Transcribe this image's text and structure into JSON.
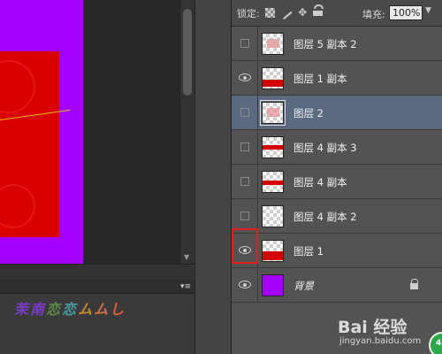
{
  "lock_bar": {
    "lock_label": "锁定:",
    "fill_label": "填充:",
    "fill_value": "100%"
  },
  "layers": [
    {
      "name": "图层 5 副本 2",
      "visible": false,
      "thumb": "pink-swatch"
    },
    {
      "name": "图层 1 副本",
      "visible": true,
      "thumb": "red-band"
    },
    {
      "name": "图层 2",
      "visible": false,
      "thumb": "pink-swatch",
      "selected": true
    },
    {
      "name": "图层 4 副本 3",
      "visible": false,
      "thumb": "red-band"
    },
    {
      "name": "图层 4 副本",
      "visible": false,
      "thumb": "red-band"
    },
    {
      "name": "图层 4 副本 2",
      "visible": false,
      "thumb": "transparent"
    },
    {
      "name": "图层 1",
      "visible": true,
      "thumb": "red-flag",
      "highlighted": true
    },
    {
      "name": "背景",
      "visible": true,
      "thumb": "purple",
      "locked": true
    }
  ],
  "styles_panel": {
    "glyphs": [
      "茉",
      "南",
      "恋",
      "恋",
      "ム",
      "ム",
      "し"
    ]
  },
  "watermark": {
    "brand": "Bai 经验",
    "url": "jingyan.baidu.com"
  },
  "colors": {
    "canvas_bg": "#a300ff",
    "artwork_red": "#d80000",
    "selection": "#5b6a80",
    "highlight_box": "#e0201c"
  }
}
